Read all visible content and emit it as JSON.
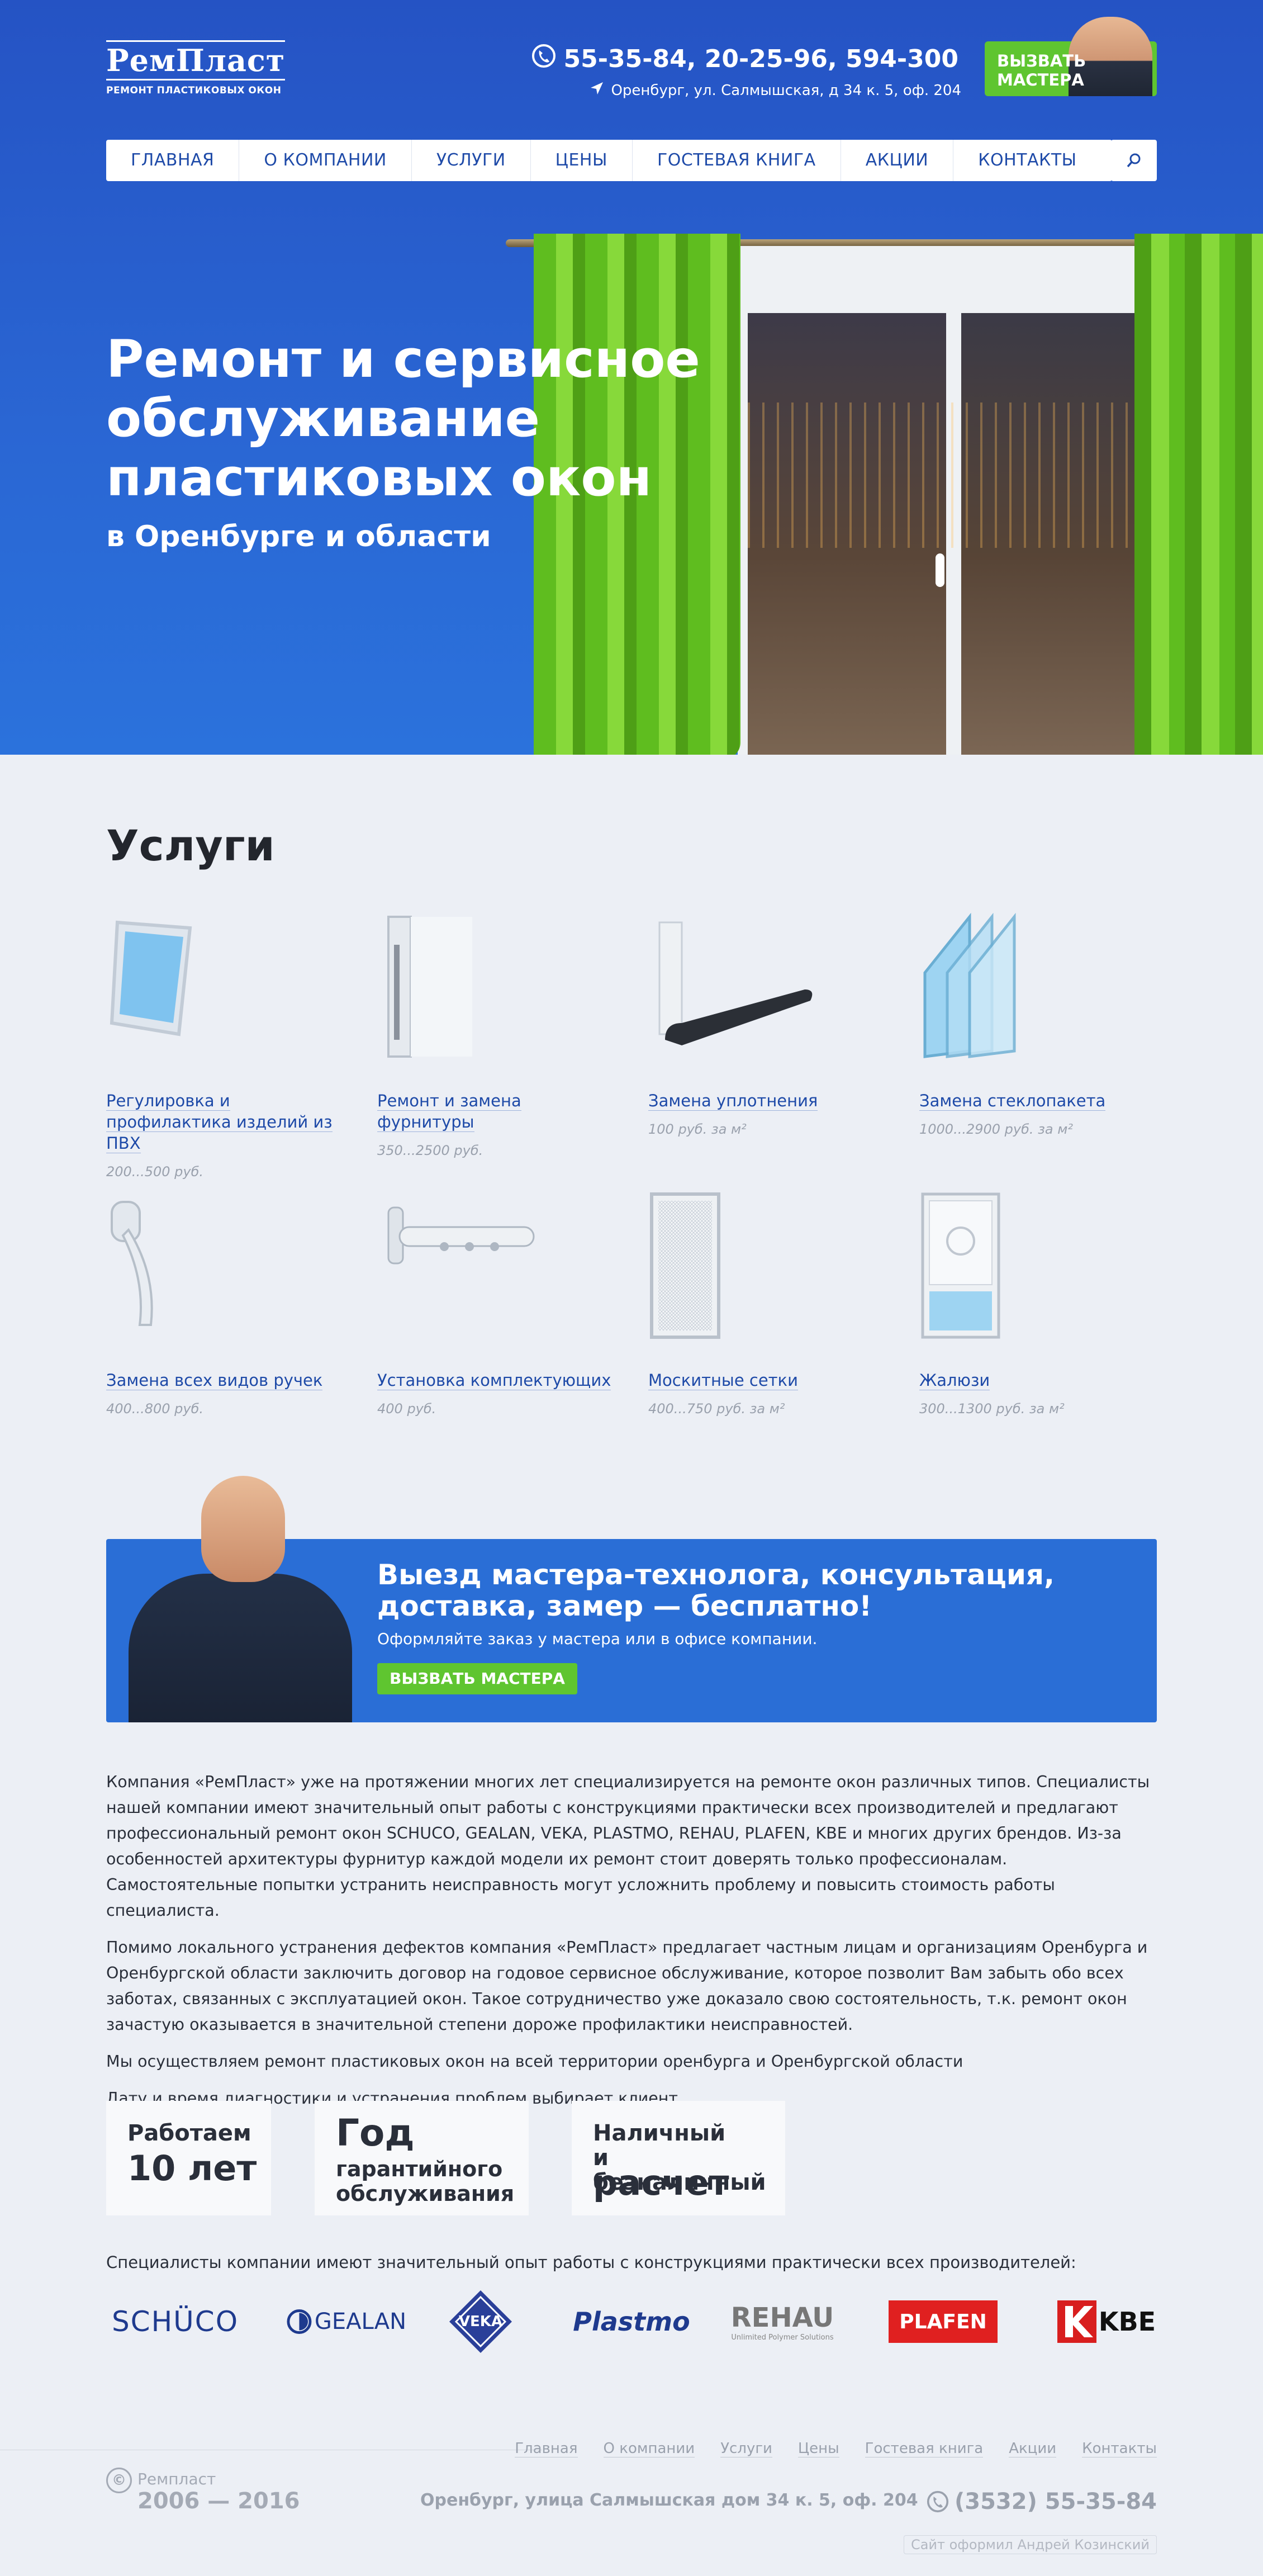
{
  "header": {
    "logo_name": "РемПласт",
    "logo_sub": "РЕМОНТ ПЛАСТИКОВЫХ ОКОН",
    "phones": "55-35-84, 20-25-96, 594-300",
    "address": "Оренбург, ул. Салмышская, д 34 к. 5, оф. 204",
    "call_button": "ВЫЗВАТЬ\nМАСТЕРА"
  },
  "nav": [
    "ГЛАВНАЯ",
    "О КОМПАНИИ",
    "УСЛУГИ",
    "ЦЕНЫ",
    "ГОСТЕВАЯ КНИГА",
    "АКЦИИ",
    "КОНТАКТЫ"
  ],
  "hero": {
    "title": "Ремонт и сервисное обслуживание пластиковых окон",
    "subtitle": "в Оренбурге и области"
  },
  "services": {
    "title": "Услуги",
    "items": [
      {
        "label": "Регулировка и профилактика изделий из ПВХ",
        "price": "200...500 руб."
      },
      {
        "label": "Ремонт и замена фурнитуры",
        "price": "350...2500 руб."
      },
      {
        "label": "Замена уплотнения",
        "price": "100 руб. за м²"
      },
      {
        "label": "Замена стеклопакета",
        "price": "1000...2900 руб. за м²"
      },
      {
        "label": "Замена всех видов ручек",
        "price": "400...800 руб."
      },
      {
        "label": "Установка комплектующих",
        "price": "400 руб."
      },
      {
        "label": "Москитные сетки",
        "price": "400...750 руб. за м²"
      },
      {
        "label": "Жалюзи",
        "price": "300...1300 руб. за м²"
      }
    ]
  },
  "promo": {
    "title": "Выезд мастера-технолога, консультация, доставка, замер — бесплатно!",
    "subtitle": "Оформляйте заказ у мастера или в офисе компании.",
    "button": "ВЫЗВАТЬ МАСТЕРА"
  },
  "about": [
    "Компания «РемПласт» уже на протяжении многих  лет специализируется на ремонте окон различных типов. Специалисты нашей компании имеют значительный опыт работы с конструкциями практически всех производителей и предлагают профессиональный ремонт окон SCHUCO, GEALAN, VEKA, PLASTMO, REHAU, PLAFEN, KBE и многих других брендов. Из-за особенностей архитектуры фурнитур каждой модели их ремонт стоит доверять только профессионалам. Самостоятельные попытки устранить неисправность могут усложнить проблему и повысить стоимость работы специалиста.",
    "Помимо локального устранения дефектов компания «РемПласт» предлагает частным лицам и организациям Оренбурга и Оренбургской области заключить договор на годовое сервисное обслуживание, которое позволит Вам забыть обо всех заботах, связанных с эксплуатацией окон. Такое сотрудничество уже доказало свою состоятельность, т.к. ремонт окон зачастую оказывается в значительной степени дороже профилактики неисправностей.",
    "Мы осуществляем ремонт пластиковых окон на всей территории оренбурга и Оренбургской области",
    "Дату и время диагностики и устранения проблем выбирает клиент."
  ],
  "features": [
    {
      "line1": "Работаем",
      "line2": "10 лет"
    },
    {
      "line1": "Год",
      "line2": "гарантийного\nобслуживания"
    },
    {
      "line1": "Наличный\nи безналичный",
      "line2": "расчет"
    }
  ],
  "brands_title": "Специалисты компании имеют значительный опыт работы с конструкциями практически всех производителей:",
  "brands": [
    "SCHÜCO",
    "GEALAN",
    "VEKA",
    "Plastmo",
    "REHAU",
    "PLAFEN",
    "KBE"
  ],
  "brand_rehau_sub": "Unlimited Polymer Solutions",
  "footer": {
    "nav": [
      "Главная",
      "О компании",
      "Услуги",
      "Цены",
      "Гостевая книга",
      "Акции",
      "Контакты"
    ],
    "copyright_name": "Ремпласт",
    "copyright_years": "2006 — 2016",
    "address": "Оренбург, улица Салмышская дом 34 к. 5, оф. 204",
    "phone": "(3532) 55-35-84",
    "credit": "Сайт оформил Андрей Козинский"
  },
  "colors": {
    "brand_blue": "#2a6ed6",
    "accent_green": "#5fc530",
    "link_blue": "#1e4aa8"
  }
}
